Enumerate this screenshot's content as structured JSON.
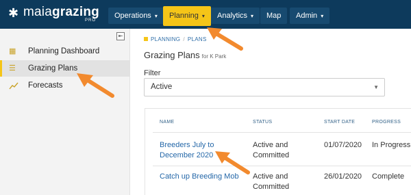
{
  "app": {
    "logo_text_light": "maia",
    "logo_text_bold": "grazing",
    "logo_sub": "PRO"
  },
  "topnav": [
    {
      "label": "Operations",
      "has_dropdown": true,
      "active": false
    },
    {
      "label": "Planning",
      "has_dropdown": true,
      "active": true
    },
    {
      "label": "Analytics",
      "has_dropdown": true,
      "active": false
    },
    {
      "label": "Map",
      "has_dropdown": false,
      "active": false
    },
    {
      "label": "Admin",
      "has_dropdown": true,
      "active": false
    }
  ],
  "sidebar": {
    "items": [
      {
        "label": "Planning Dashboard",
        "icon": "dashboard-icon",
        "selected": false
      },
      {
        "label": "Grazing Plans",
        "icon": "grazing-plans-icon",
        "selected": true
      },
      {
        "label": "Forecasts",
        "icon": "chart-line-icon",
        "selected": false
      }
    ]
  },
  "breadcrumb": [
    "PLANNING",
    "PLANS"
  ],
  "page": {
    "title": "Grazing Plans",
    "subtitle": "for K Park"
  },
  "filter": {
    "label": "Filter",
    "value": "Active"
  },
  "table": {
    "columns": [
      "NAME",
      "STATUS",
      "START DATE",
      "PROGRESS"
    ],
    "rows": [
      {
        "name_line1": "Breeders July to",
        "name_line2": "December 2020",
        "status_line1": "Active and",
        "status_line2": "Committed",
        "start_date": "01/07/2020",
        "progress": "In Progress"
      },
      {
        "name_line1": "Catch up Breeding Mob",
        "name_line2": "",
        "status_line1": "Active and",
        "status_line2": "Committed",
        "start_date": "26/01/2020",
        "progress": "Complete"
      }
    ]
  },
  "colors": {
    "topbar": "#0d3a5c",
    "accent": "#f5c518",
    "link": "#2467a8",
    "annotation_arrow": "#f28a2e"
  }
}
